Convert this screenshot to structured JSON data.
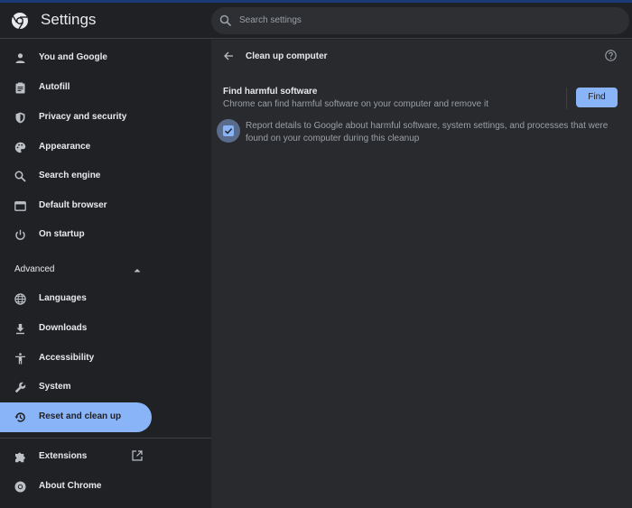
{
  "app": {
    "title": "Settings"
  },
  "search": {
    "placeholder": "Search settings"
  },
  "sidebar": {
    "items": [
      {
        "label": "You and Google",
        "icon": "person-icon"
      },
      {
        "label": "Autofill",
        "icon": "clipboard-icon"
      },
      {
        "label": "Privacy and security",
        "icon": "shield-icon"
      },
      {
        "label": "Appearance",
        "icon": "palette-icon"
      },
      {
        "label": "Search engine",
        "icon": "search-icon"
      },
      {
        "label": "Default browser",
        "icon": "browser-icon"
      },
      {
        "label": "On startup",
        "icon": "power-icon"
      }
    ],
    "advanced_label": "Advanced",
    "advanced_items": [
      {
        "label": "Languages",
        "icon": "globe-icon"
      },
      {
        "label": "Downloads",
        "icon": "download-icon"
      },
      {
        "label": "Accessibility",
        "icon": "accessibility-icon"
      },
      {
        "label": "System",
        "icon": "wrench-icon"
      },
      {
        "label": "Reset and clean up",
        "icon": "restore-icon",
        "active": true
      }
    ],
    "footer_items": [
      {
        "label": "Extensions",
        "icon": "puzzle-icon"
      },
      {
        "label": "About Chrome",
        "icon": "chrome-icon"
      }
    ]
  },
  "main": {
    "page_title": "Clean up computer",
    "section_title": "Find harmful software",
    "section_subtitle": "Chrome can find harmful software on your computer and remove it",
    "find_button": "Find",
    "report_checkbox": {
      "checked": true,
      "label": "Report details to Google about harmful software, system settings, and processes that were found on your computer during this cleanup"
    }
  },
  "colors": {
    "accent": "#8ab4f8",
    "background": "#202124",
    "panel": "#292a2d",
    "text": "#e8eaed",
    "secondary_text": "#9aa0a6"
  }
}
